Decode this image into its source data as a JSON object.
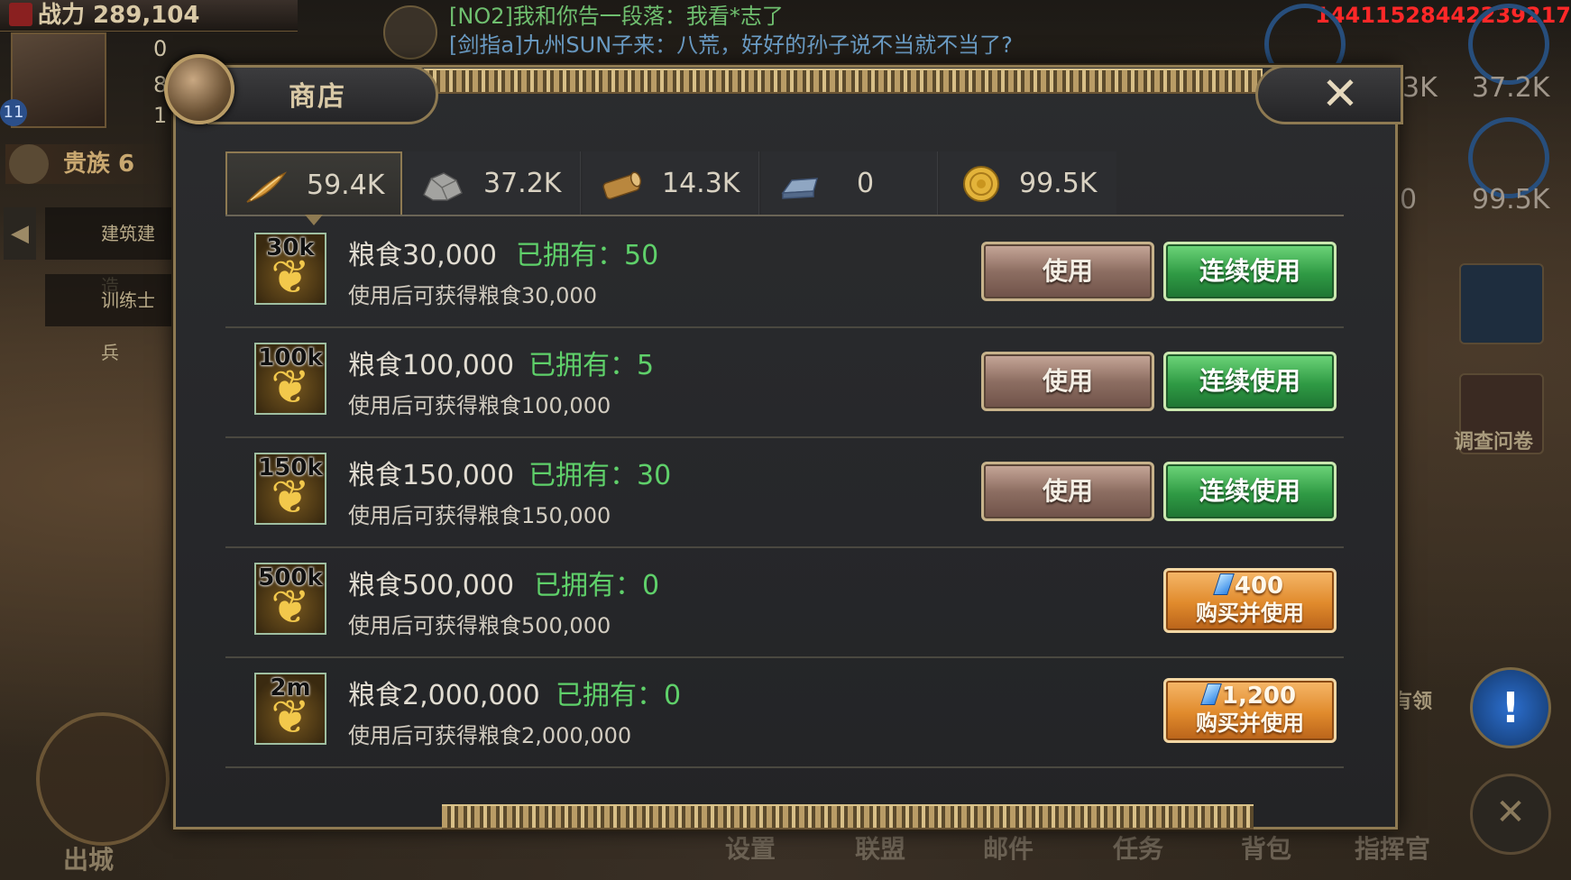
{
  "hud": {
    "power_label": "战力 289,104",
    "chat_line1": "[NO2]我和你告一段落：我看*志了",
    "chat_line2": "[剑指a]九州SUN子来：八荒，好好的孙子说不当就不当了?",
    "user_id": "14411528442239217",
    "side_stat1": "0",
    "side_stat2": "8",
    "side_stat3": "1",
    "level": "11",
    "noble_label": "贵族  6",
    "queue_build": "建筑建造",
    "queue_train": "训练士兵",
    "right_res1": "3K",
    "right_res2": "37.2K",
    "right_res3": "0",
    "right_res4": "99.5K",
    "survey_label": "调查问卷",
    "claim_label": "有领",
    "out_city_label": "出城",
    "nav": [
      "设置",
      "联盟",
      "邮件",
      "任务",
      "背包",
      "指挥官"
    ]
  },
  "shop": {
    "title": "商店",
    "close_icon": "✕",
    "resources": [
      {
        "icon": "feather-wheat-icon",
        "value": "59.4K",
        "active": true
      },
      {
        "icon": "stone-icon",
        "value": "37.2K",
        "active": false
      },
      {
        "icon": "wood-log-icon",
        "value": "14.3K",
        "active": false
      },
      {
        "icon": "iron-ingot-icon",
        "value": "0",
        "active": false
      },
      {
        "icon": "gold-coin-icon",
        "value": "99.5K",
        "active": false
      }
    ],
    "owned_label": "已拥有：",
    "use_label": "使用",
    "continuous_use_label": "连续使用",
    "buy_use_label": "购买并使用",
    "items": [
      {
        "amount_badge": "30k",
        "name": "粮食30,000",
        "owned": "50",
        "desc": "使用后可获得粮食30,000"
      },
      {
        "amount_badge": "100k",
        "name": "粮食100,000",
        "owned": "5",
        "desc": "使用后可获得粮食100,000"
      },
      {
        "amount_badge": "150k",
        "name": "粮食150,000",
        "owned": "30",
        "desc": "使用后可获得粮食150,000"
      },
      {
        "amount_badge": "500k",
        "name": "粮食500,000",
        "owned": "0",
        "desc": "使用后可获得粮食500,000",
        "price": "400"
      },
      {
        "amount_badge": "2m",
        "name": "粮食2,000,000",
        "owned": "0",
        "desc": "使用后可获得粮食2,000,000",
        "price": "1,200"
      }
    ]
  },
  "colors": {
    "owned_green": "#5fd06a",
    "gold_border": "#8e7a52",
    "uid_red": "#ff2828"
  }
}
